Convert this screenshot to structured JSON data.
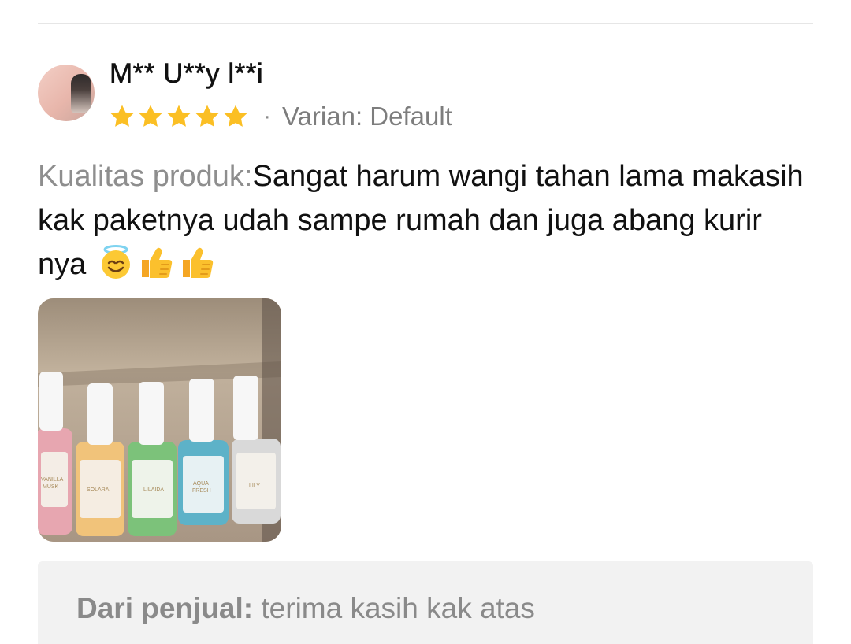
{
  "review": {
    "username": "M** U**y l**i",
    "rating": 5,
    "rating_max": 5,
    "separator": "·",
    "variant": "Varian: Default",
    "quality_label": "Kualitas produk:",
    "text": "Sangat harum wangi tahan lama makasih kak paketnya udah sampe rumah dan juga abang kurir nya",
    "emojis": [
      "smiling-face-with-halo-icon",
      "thumbs-up-icon",
      "thumbs-up-icon"
    ],
    "photo": {
      "subject": "review-photo",
      "bottles": [
        {
          "label": "VANILLA MUSK",
          "color": "#e7a6b0"
        },
        {
          "label": "SOLARA",
          "color": "#f1c37a"
        },
        {
          "label": "LILAIDA",
          "color": "#7cc27a"
        },
        {
          "label": "AQUA FRESH",
          "color": "#5db2c8"
        },
        {
          "label": "LILY",
          "color": "#d9d9d9"
        }
      ]
    }
  },
  "seller_reply": {
    "label": "Dari penjual:",
    "text": "terima kasih kak atas"
  },
  "colors": {
    "star": "#fbbf24",
    "muted_text": "#8a8a8a",
    "primary_text": "#111111",
    "seller_bg": "#f2f2f2"
  }
}
